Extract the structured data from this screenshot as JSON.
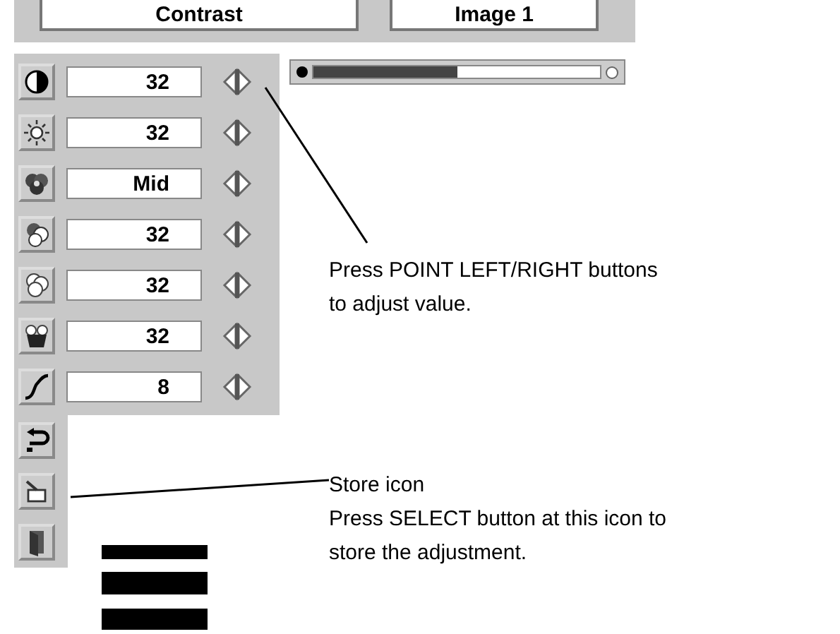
{
  "top_buttons": [
    {
      "label": "Contrast"
    },
    {
      "label": "Image 1"
    }
  ],
  "rows": [
    {
      "value": "32"
    },
    {
      "value": "32"
    },
    {
      "value": "Mid"
    },
    {
      "value": "32"
    },
    {
      "value": "32"
    },
    {
      "value": "32"
    },
    {
      "value": "8"
    }
  ],
  "slider": {
    "level": 0.5
  },
  "callouts": [
    {
      "text": "Press POINT LEFT/RIGHT buttons to adjust value."
    },
    {
      "title": "Store icon",
      "text": "Press SELECT button at this icon to store the adjustment."
    }
  ]
}
